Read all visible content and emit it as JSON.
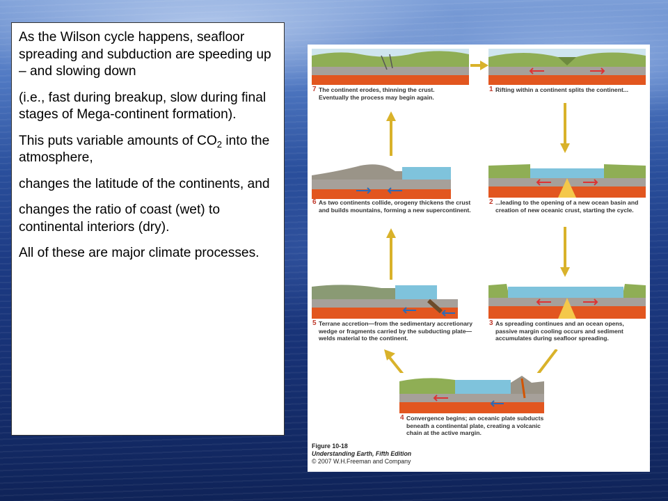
{
  "text_box": {
    "p1": "As the Wilson cycle happens, seafloor spreading and subduction are speeding up – and slowing down",
    "p2": "(i.e., fast during breakup, slow during final stages of Mega-continent formation).",
    "p3_prefix": "This puts variable amounts of CO",
    "p3_sub": "2",
    "p3_suffix": " into the atmosphere,",
    "p4": "changes the latitude of the continents, and",
    "p5": "changes the ratio of coast (wet) to continental interiors (dry).",
    "p6": "All of these are major climate processes."
  },
  "figure": {
    "panels": [
      {
        "num": "1",
        "caption": "Rifting within a continent splits the continent..."
      },
      {
        "num": "2",
        "caption": "...leading to the opening of a new ocean basin and creation of new oceanic crust, starting the cycle."
      },
      {
        "num": "3",
        "caption": "As spreading continues and an ocean opens, passive margin cooling occurs and sediment accumulates during seafloor spreading."
      },
      {
        "num": "4",
        "caption": "Convergence begins; an oceanic plate subducts beneath a continental plate, creating a volcanic chain at the active margin."
      },
      {
        "num": "5",
        "caption": "Terrane accretion—from the sedimentary accretionary wedge or fragments carried by the subducting plate—welds material to the continent."
      },
      {
        "num": "6",
        "caption": "As two continents collide, orogeny thickens the crust and builds mountains, forming a new supercontinent."
      },
      {
        "num": "7",
        "caption": "The continent erodes, thinning the crust. Eventually the process may begin again."
      }
    ],
    "credit_figure": "Figure 10-18",
    "credit_book": "Understanding Earth, Fifth Edition",
    "credit_copyright": "© 2007 W.H.Freeman and Company"
  },
  "colors": {
    "arrow": "#d9b22a",
    "mantle": "#e2561f",
    "ocean": "#7fc3dc",
    "land": "#8fae55",
    "crust": "#a6a09a"
  }
}
